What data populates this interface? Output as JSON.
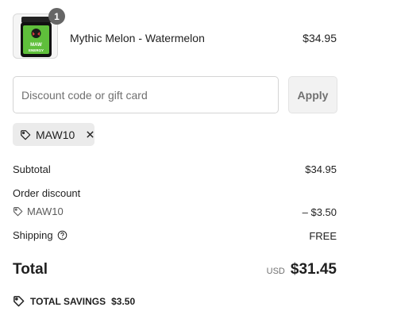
{
  "product": {
    "name": "Mythic Melon - Watermelon",
    "price": "$34.95",
    "quantity": "1",
    "image_text": "MAW ENERGY"
  },
  "discount": {
    "placeholder": "Discount code or gift card",
    "value": "",
    "apply_label": "Apply",
    "applied_code": "MAW10"
  },
  "summary": {
    "subtotal_label": "Subtotal",
    "subtotal_value": "$34.95",
    "order_discount_label": "Order discount",
    "discount_code": "MAW10",
    "discount_value": "– $3.50",
    "shipping_label": "Shipping",
    "shipping_value": "FREE",
    "total_label": "Total",
    "currency": "USD",
    "total_value": "$31.45",
    "savings_label": "TOTAL SAVINGS",
    "savings_value": "$3.50"
  },
  "colors": {
    "badge": "#666666",
    "chip_bg": "#ebebeb",
    "apply_bg": "#f2f2f2",
    "can_green": "#5fbf3b"
  }
}
